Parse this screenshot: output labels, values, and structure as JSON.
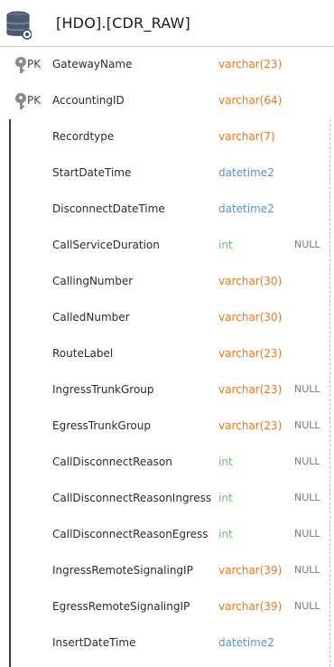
{
  "table": {
    "name": "[HDO].[CDR_RAW]",
    "icon": "database-icon"
  },
  "colors": {
    "varchar": "#e8782a",
    "datetime": "#5b8fce",
    "int": "#6fbf73",
    "null": "#7a7a7a"
  },
  "primary_key_columns": [
    {
      "key": "PK",
      "key_icon": "key-icon",
      "name": "GatewayName",
      "type": "varchar(23)",
      "type_class": "varchar"
    },
    {
      "key": "PK",
      "key_icon": "key-icon",
      "name": "AccountingID",
      "type": "varchar(64)",
      "type_class": "varchar"
    }
  ],
  "columns": [
    {
      "name": "Recordtype",
      "type": "varchar(7)",
      "type_class": "varchar",
      "nullable": ""
    },
    {
      "name": "StartDateTime",
      "type": "datetime2",
      "type_class": "datetime",
      "nullable": ""
    },
    {
      "name": "DisconnectDateTime",
      "type": "datetime2",
      "type_class": "datetime",
      "nullable": ""
    },
    {
      "name": "CallServiceDuration",
      "type": "int",
      "type_class": "int",
      "nullable": "NULL"
    },
    {
      "name": "CallingNumber",
      "type": "varchar(30)",
      "type_class": "varchar",
      "nullable": ""
    },
    {
      "name": "CalledNumber",
      "type": "varchar(30)",
      "type_class": "varchar",
      "nullable": ""
    },
    {
      "name": "RouteLabel",
      "type": "varchar(23)",
      "type_class": "varchar",
      "nullable": ""
    },
    {
      "name": "IngressTrunkGroup",
      "type": "varchar(23)",
      "type_class": "varchar",
      "nullable": "NULL"
    },
    {
      "name": "EgressTrunkGroup",
      "type": "varchar(23)",
      "type_class": "varchar",
      "nullable": "NULL"
    },
    {
      "name": "CallDisconnectReason",
      "type": "int",
      "type_class": "int",
      "nullable": "NULL"
    },
    {
      "name": "CallDisconnectReasonIngress",
      "type": "int",
      "type_class": "int",
      "nullable": "NULL"
    },
    {
      "name": "CallDisconnectReasonEgress",
      "type": "int",
      "type_class": "int",
      "nullable": "NULL"
    },
    {
      "name": "IngressRemoteSignalingIP",
      "type": "varchar(39)",
      "type_class": "varchar",
      "nullable": "NULL"
    },
    {
      "name": "EgressRemoteSignalingIP",
      "type": "varchar(39)",
      "type_class": "varchar",
      "nullable": "NULL"
    },
    {
      "name": "InsertDateTime",
      "type": "datetime2",
      "type_class": "datetime",
      "nullable": ""
    }
  ]
}
